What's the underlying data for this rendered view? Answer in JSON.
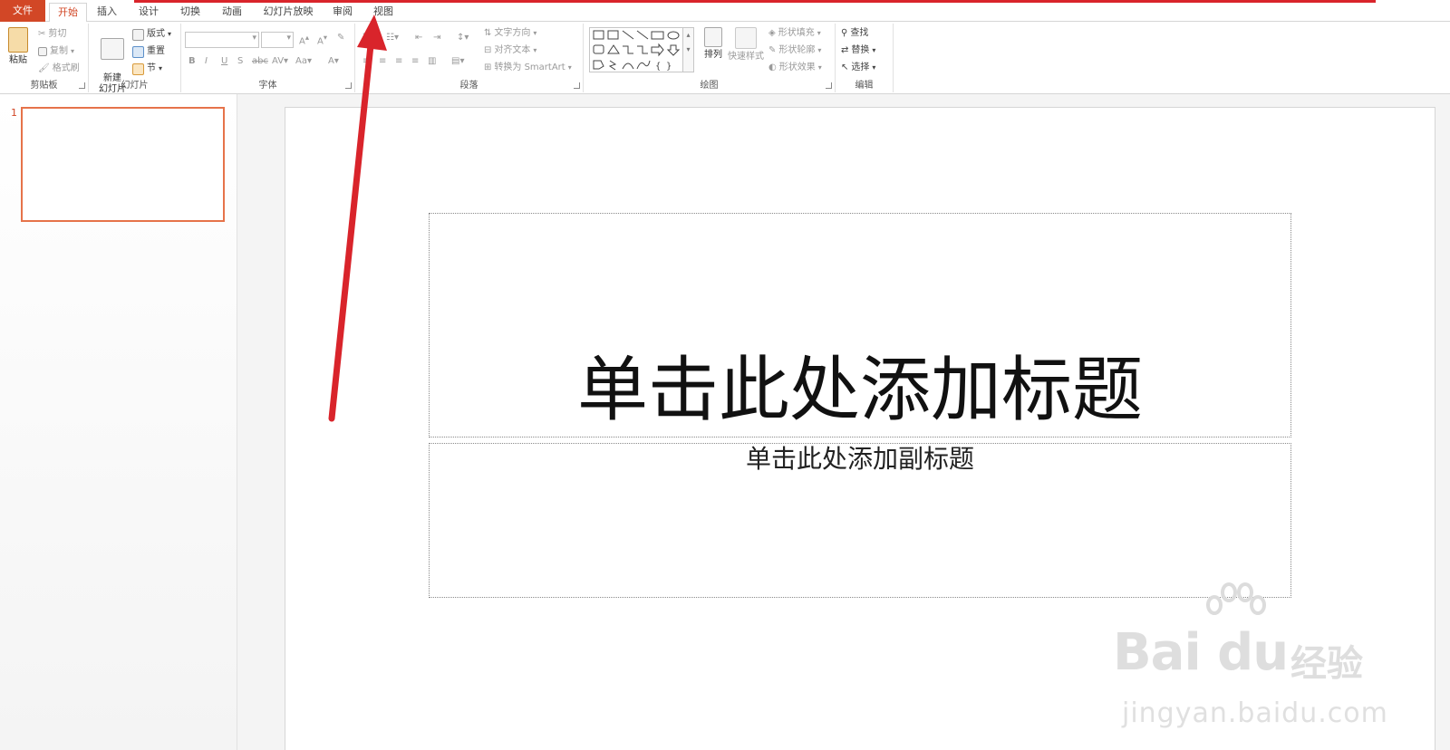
{
  "tabs": [
    {
      "label": "文件"
    },
    {
      "label": "开始"
    },
    {
      "label": "插入"
    },
    {
      "label": "设计"
    },
    {
      "label": "切换"
    },
    {
      "label": "动画"
    },
    {
      "label": "幻灯片放映"
    },
    {
      "label": "审阅"
    },
    {
      "label": "视图"
    }
  ],
  "ribbon": {
    "clipboard": {
      "label": "剪贴板",
      "paste": "粘贴",
      "cut": "剪切",
      "copy": "复制",
      "format_painter": "格式刷"
    },
    "slides": {
      "label": "幻灯片",
      "new_slide": "新建\n幻灯片",
      "layout": "版式",
      "reset": "重置",
      "section": "节"
    },
    "font": {
      "label": "字体"
    },
    "paragraph": {
      "label": "段落",
      "text_direction": "文字方向",
      "align_text": "对齐文本",
      "convert_smartart": "转换为 SmartArt"
    },
    "drawing": {
      "label": "绘图",
      "arrange": "排列",
      "quick_styles": "快速样式",
      "shape_fill": "形状填充",
      "shape_outline": "形状轮廓",
      "shape_effects": "形状效果"
    },
    "editing": {
      "label": "编辑",
      "find": "查找",
      "replace": "替换",
      "select": "选择"
    }
  },
  "thumbnails": {
    "number": "1"
  },
  "slide": {
    "title_placeholder": "单击此处添加标题",
    "subtitle_placeholder": "单击此处添加副标题"
  },
  "watermark": {
    "brand": "Bai du",
    "brand2": "经验",
    "url": "jingyan.baidu.com"
  },
  "colors": {
    "accent": "#d24726",
    "annotation": "#d9242b"
  }
}
